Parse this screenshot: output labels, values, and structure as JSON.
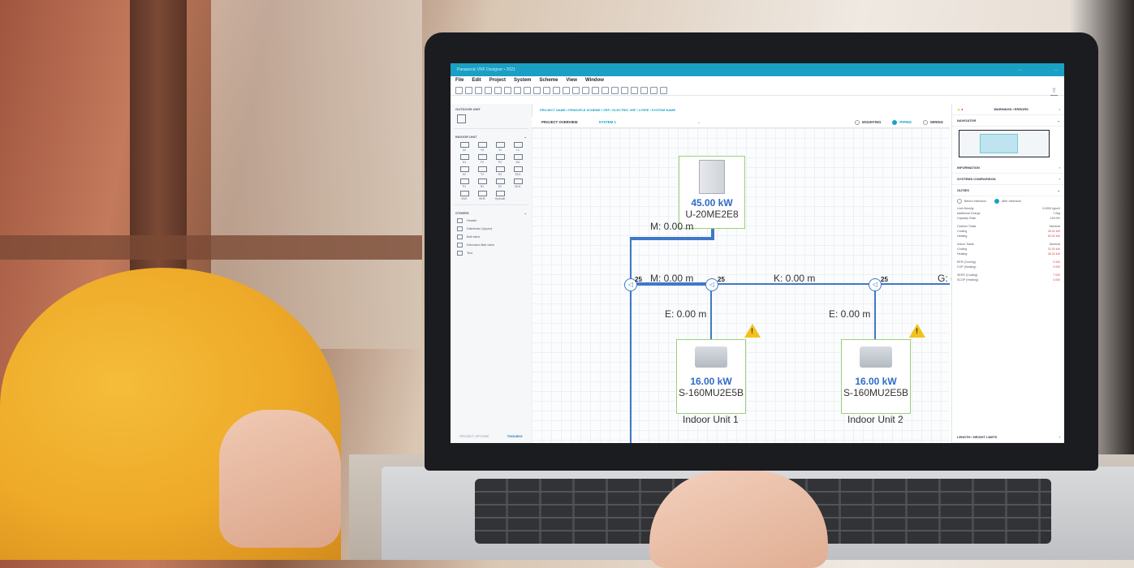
{
  "app": {
    "title": "Panasonic VRF Designer • 2021",
    "account_left": "...",
    "account_right": "..."
  },
  "menu": [
    "File",
    "Edit",
    "Project",
    "System",
    "Scheme",
    "View",
    "Window"
  ],
  "left_panel": {
    "outdoor_header": "OUTDOOR UNIT",
    "indoor_header": "INDOOR UNIT",
    "indoor_units": [
      "U2",
      "Y3",
      "Y2",
      "L1",
      "D1",
      "F2",
      "P2",
      "M1",
      "K2",
      "T2",
      "K2",
      "DU1",
      "P1",
      "R1",
      "E2",
      "MH1",
      "M1E",
      "WHE",
      "Hydrokit"
    ],
    "others_header": "OTHERS",
    "others": [
      "Header",
      "Distributor (Upper)",
      "Ball valve",
      "Extension Ball valve",
      "Text"
    ],
    "tabs": [
      "PROJECT OPTIONS",
      "TOOLBOX"
    ]
  },
  "breadcrumb": "PROJECT NAME / PRINCIPLE SCHEME / VRF / ELECTRIC VRF / 2-PIPE / SYSTEM NAME",
  "subbar": {
    "overview": "PROJECT OVERVIEW",
    "system": "SYSTEM 1",
    "views": [
      "MOUNTING",
      "PIPING",
      "WIRING"
    ]
  },
  "diagram": {
    "outdoor": {
      "power": "45.00 kW",
      "model": "U-20ME2E8"
    },
    "pipes": {
      "m_vertical": "M: 0.00 m",
      "m_horizontal": "M: 0.00 m",
      "k": "K: 0.00 m",
      "e1": "E: 0.00 m",
      "e2": "E: 0.00 m",
      "g": "G: ("
    },
    "joints": [
      "25",
      "25",
      "25"
    ],
    "indoor1": {
      "power": "16.00 kW",
      "model": "S-160MU2E5B",
      "name": "Indoor Unit 1"
    },
    "indoor2": {
      "power": "16.00 kW",
      "model": "S-160MU2E5B",
      "name": "Indoor Unit 2"
    }
  },
  "right_panel": {
    "warnings": "WARNINGS / ERRORS",
    "navigator": "NAVIGATOR",
    "information": "INFORMATION",
    "comparison": "SYSTEMS COMPARISON",
    "outies": "OUTIES",
    "radio1": "Before extension",
    "radio2": "After extension",
    "kv": [
      [
        "Limit Density",
        "0.0000 kg/m3"
      ],
      [
        "Additional Charge",
        "7.0kg"
      ],
      [
        "Capacity Ratio",
        "109.0%"
      ],
      [
        "Outdoor Totals",
        "Nominal"
      ],
      [
        "Cooling",
        "45.00 kW"
      ],
      [
        "Heating",
        "50.00 kW"
      ],
      [
        "Indoor Totals",
        "Nominal"
      ],
      [
        "Cooling",
        "32.00 kW"
      ],
      [
        "Heating",
        "36.00 kW"
      ],
      [
        "EER (Cooling)",
        "3.300"
      ],
      [
        "COP (Heating)",
        "3.900"
      ],
      [
        "SEER (Cooling)",
        "7.000"
      ],
      [
        "SCOP (Heating)",
        "4.000"
      ]
    ],
    "length": "LENGTH / HEIGHT LIMITS"
  }
}
